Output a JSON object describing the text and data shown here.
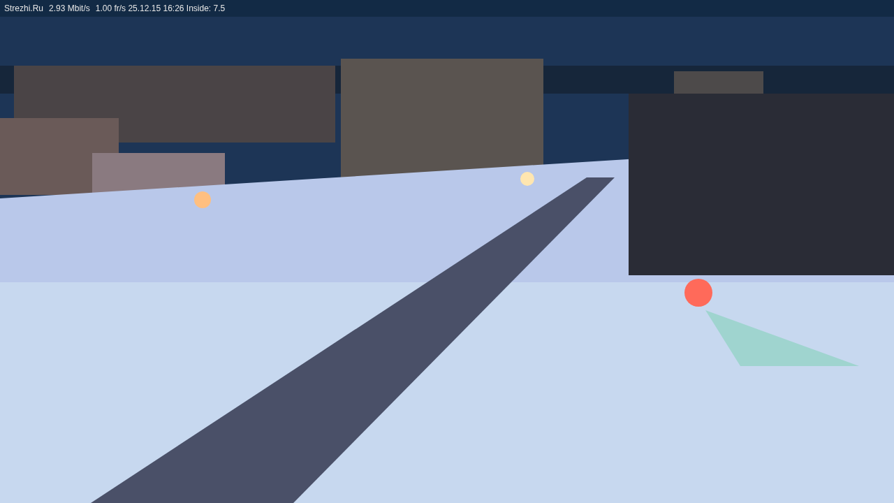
{
  "status_bar": {
    "items": [
      "Strezhi.Ru",
      "2.93 Mbit/s",
      "1.00 fr/s 25.12.15 16:26 Inside: 7.5"
    ]
  }
}
